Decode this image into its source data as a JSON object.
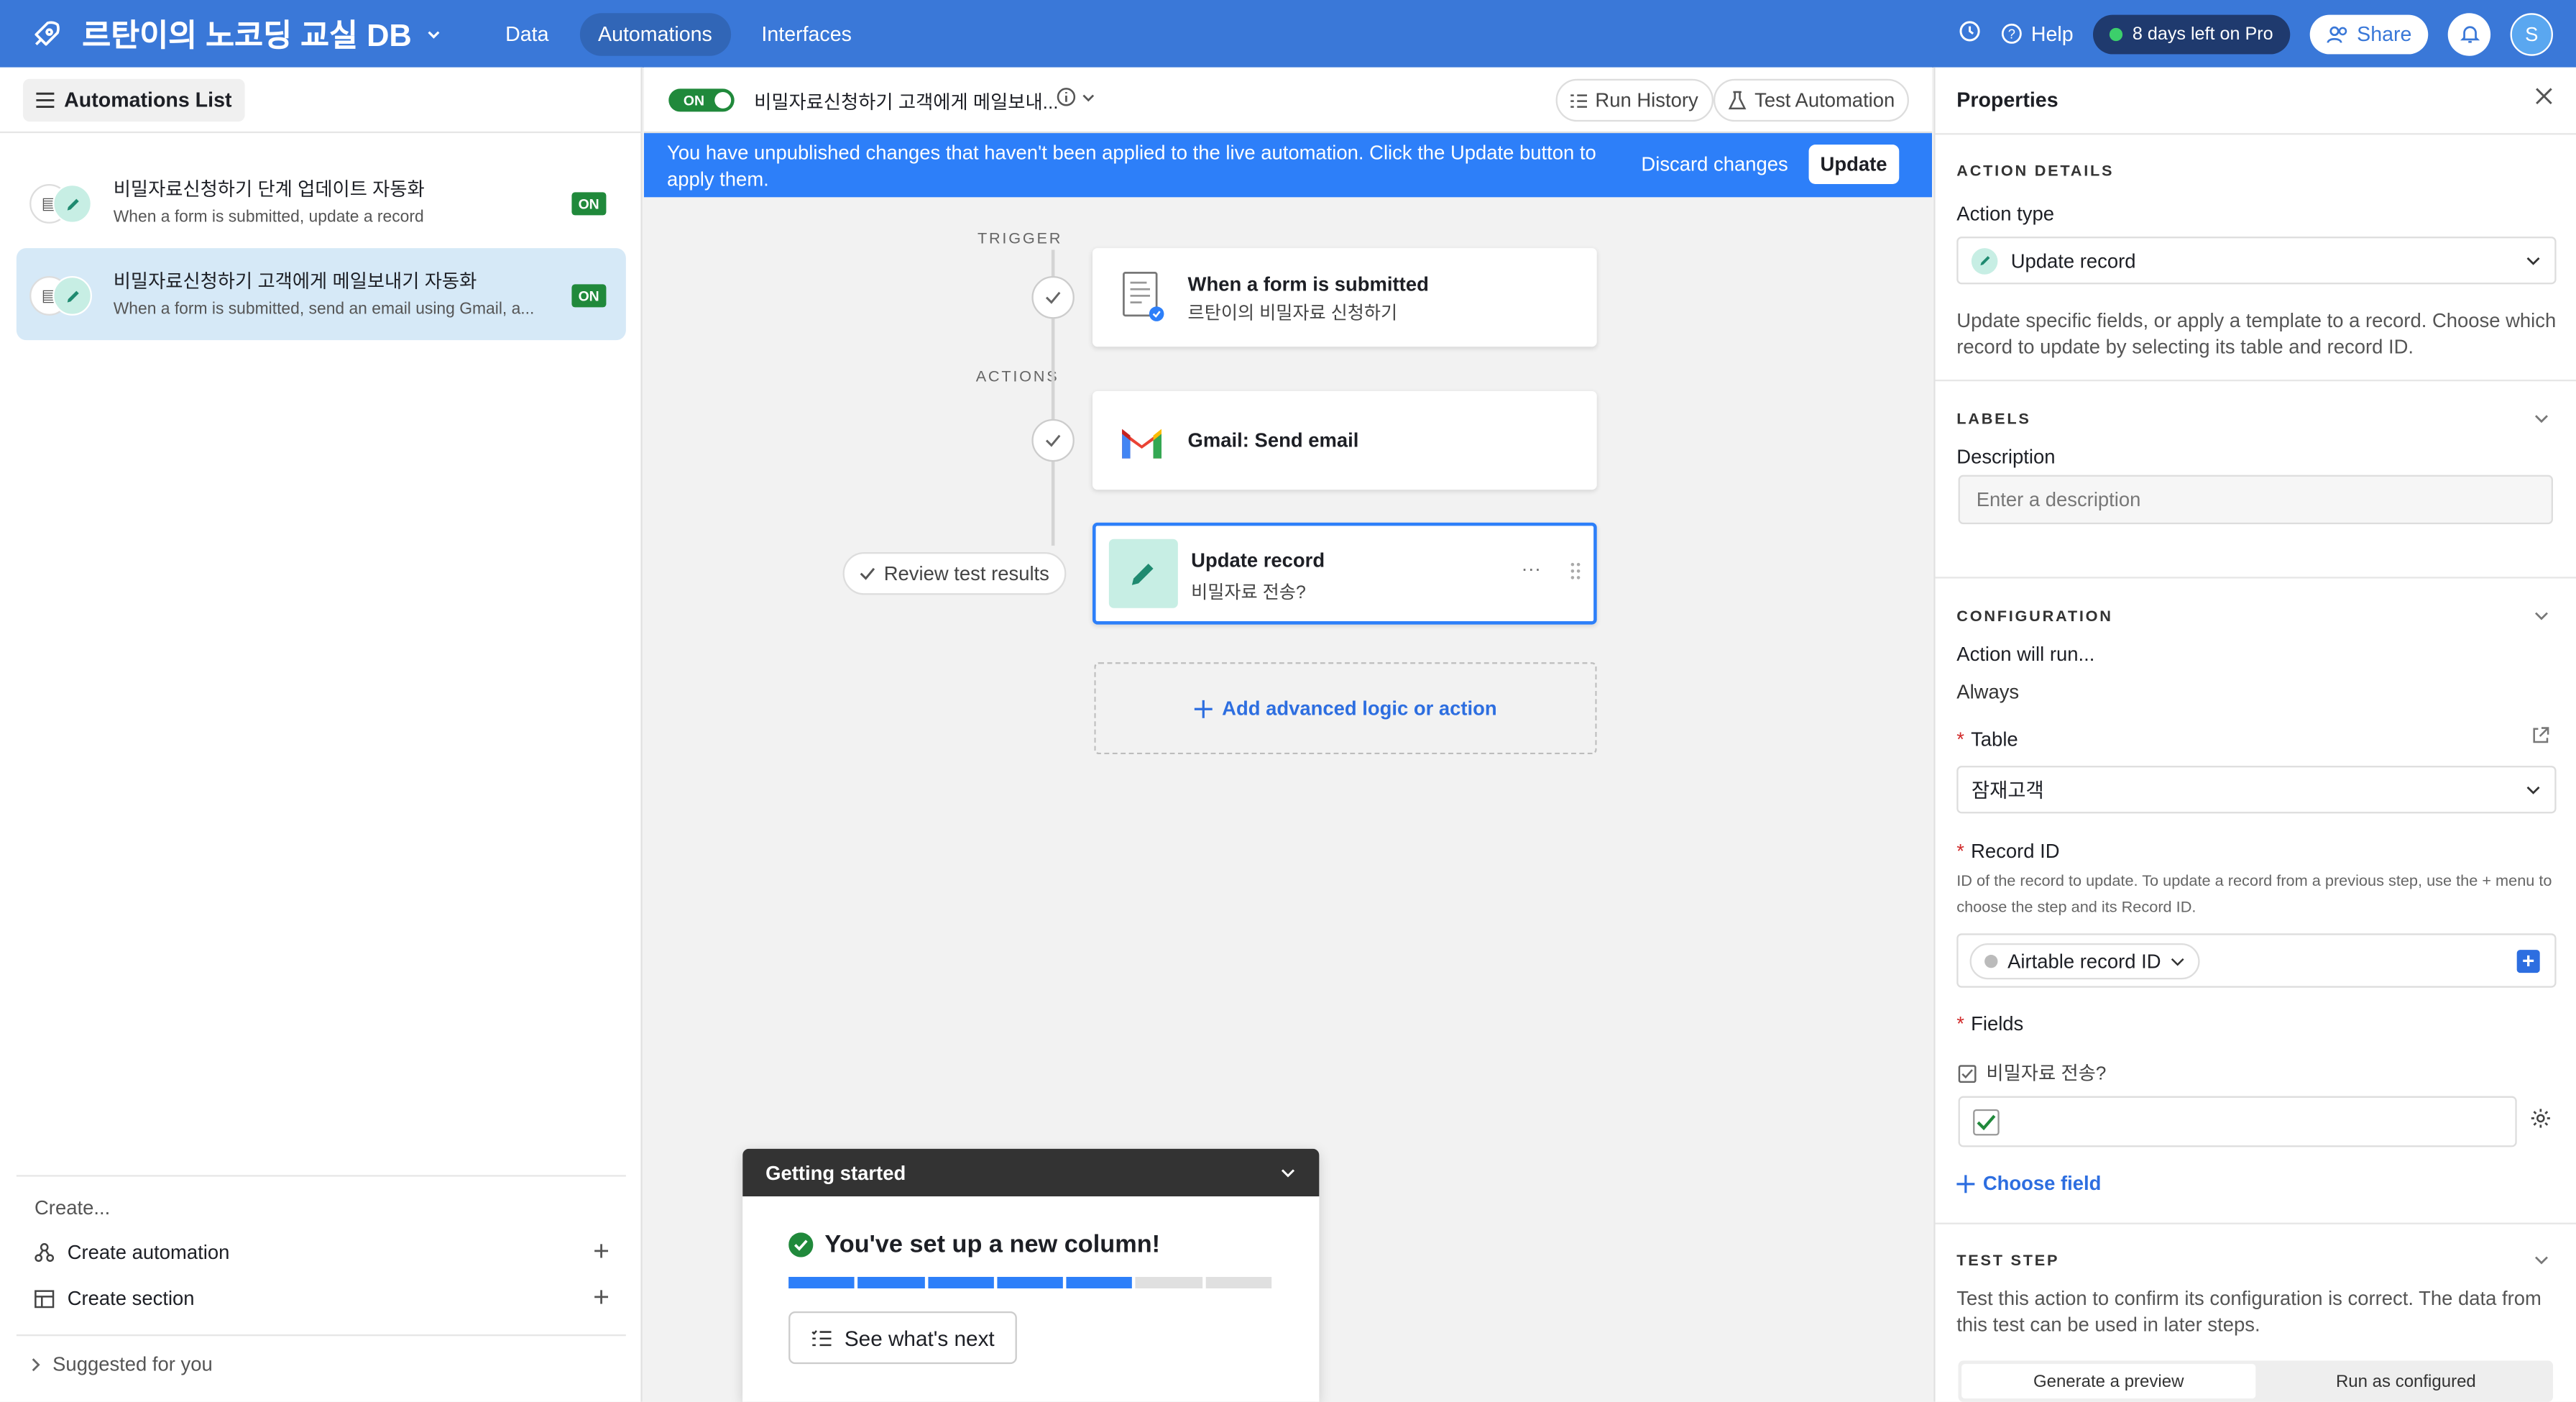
{
  "topbar": {
    "base_title": "르탄이의 노코딩 교실 DB",
    "nav": [
      "Data",
      "Automations",
      "Interfaces"
    ],
    "active_nav": "Automations",
    "help": "Help",
    "trial": "8 days left on Pro",
    "share": "Share",
    "avatar_initial": "S",
    "brand_color": "#3a78d8"
  },
  "sidebar": {
    "list_button": "Automations List",
    "automations": [
      {
        "name": "비밀자료신청하기 단계 업데이트 자동화",
        "desc": "When a form is submitted, update a record",
        "status": "ON",
        "selected": false
      },
      {
        "name": "비밀자료신청하기 고객에게 메일보내기 자동화",
        "desc": "When a form is submitted, send an email using Gmail, a...",
        "status": "ON",
        "selected": true
      }
    ],
    "create_label": "Create...",
    "create_automation": "Create automation",
    "create_section": "Create section",
    "suggested": "Suggested for you"
  },
  "editor": {
    "toggle": "ON",
    "automation_title": "비밀자료신청하기 고객에게 메일보내...",
    "run_history": "Run History",
    "test_automation": "Test Automation",
    "banner_text": "You have unpublished changes that haven't been applied to the live automation. Click the Update button to apply them.",
    "discard": "Discard changes",
    "update": "Update",
    "trigger_label": "TRIGGER",
    "actions_label": "ACTIONS",
    "trigger_card": {
      "title": "When a form is submitted",
      "sub": "르탄이의 비밀자료 신청하기"
    },
    "gmail_card": {
      "title": "Gmail: Send email"
    },
    "update_card": {
      "title": "Update record",
      "sub": "비밀자료 전송?"
    },
    "review": "Review test results",
    "add_logic": "Add advanced logic or action"
  },
  "getting_started": {
    "header": "Getting started",
    "title": "You've set up a new column!",
    "progress_done": 5,
    "progress_total": 7,
    "button": "See what's next"
  },
  "properties": {
    "title": "Properties",
    "action_details": "ACTION DETAILS",
    "action_type_label": "Action type",
    "action_type_value": "Update record",
    "action_desc": "Update specific fields, or apply a template to a record. Choose which record to update by selecting its table and record ID.",
    "labels": "LABELS",
    "description_label": "Description",
    "description_placeholder": "Enter a description",
    "configuration": "CONFIGURATION",
    "will_run": "Action will run...",
    "always": "Always",
    "table_label": "Table",
    "table_value": "잠재고객",
    "record_id_label": "Record ID",
    "record_id_help": "ID of the record to update. To update a record from a previous step, use the + menu to choose the step and its Record ID.",
    "record_id_value": "Airtable record ID",
    "fields_label": "Fields",
    "field_name": "비밀자료 전송?",
    "choose_field": "Choose field",
    "test_step": "TEST STEP",
    "test_desc": "Test this action to confirm its configuration is correct. The data from this test can be used in later steps.",
    "generate_preview": "Generate a preview",
    "run_as_configured": "Run as configured"
  }
}
